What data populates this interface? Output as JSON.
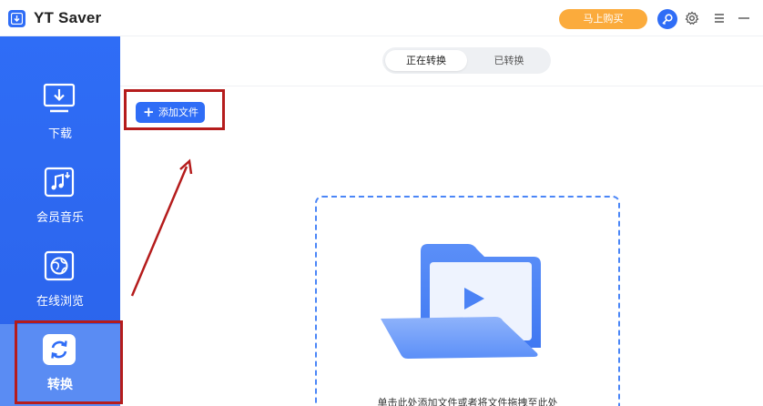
{
  "app": {
    "title": "YT Saver"
  },
  "titlebar": {
    "buy_label": "马上购买"
  },
  "sidebar": {
    "items": [
      {
        "label": "下载",
        "icon": "download-icon"
      },
      {
        "label": "会员音乐",
        "icon": "music-icon"
      },
      {
        "label": "在线浏览",
        "icon": "browser-icon"
      },
      {
        "label": "转换",
        "icon": "convert-icon"
      }
    ],
    "active_index": 3
  },
  "main": {
    "tabs": [
      {
        "label": "正在转换"
      },
      {
        "label": "已转换"
      }
    ],
    "active_tab": 0,
    "add_file_label": "添加文件",
    "drop_hint": "单击此处添加文件或者将文件拖拽至此处"
  },
  "colors": {
    "accent": "#2f6df6",
    "buy": "#fbab3c",
    "annotation": "#b51c1c"
  }
}
